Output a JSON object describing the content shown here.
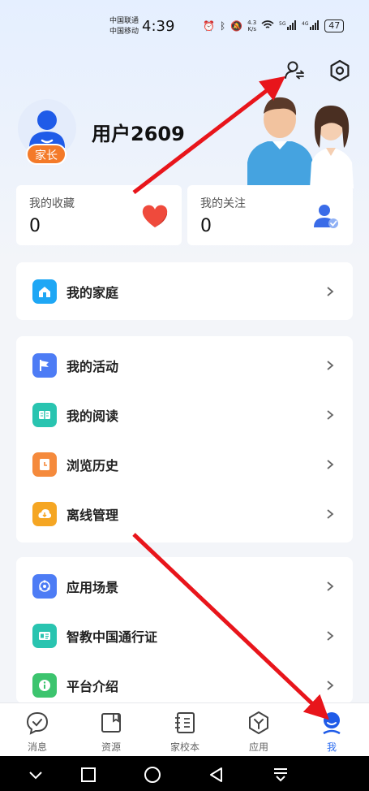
{
  "status_bar": {
    "carrier_1": "中国联通",
    "carrier_2": "中国移动",
    "time": "4:39",
    "net_speed": "4.3\nK/s",
    "battery": "47"
  },
  "profile": {
    "username": "用户2609",
    "role_badge": "家长"
  },
  "stats": [
    {
      "label": "我的收藏",
      "value": "0",
      "icon": "heart-icon"
    },
    {
      "label": "我的关注",
      "value": "0",
      "icon": "user-check-icon"
    }
  ],
  "menu_groups": [
    [
      {
        "label": "我的家庭",
        "icon": "home-icon",
        "color": "#1ea7f5"
      }
    ],
    [
      {
        "label": "我的活动",
        "icon": "flag-icon",
        "color": "#4d7cf5"
      },
      {
        "label": "我的阅读",
        "icon": "book-icon",
        "color": "#29c4b0"
      },
      {
        "label": "浏览历史",
        "icon": "history-icon",
        "color": "#f58a3c"
      },
      {
        "label": "离线管理",
        "icon": "download-icon",
        "color": "#f5a623"
      }
    ],
    [
      {
        "label": "应用场景",
        "icon": "scene-icon",
        "color": "#4d7cf5"
      },
      {
        "label": "智教中国通行证",
        "icon": "id-card-icon",
        "color": "#29c4b0"
      },
      {
        "label": "平台介绍",
        "icon": "info-icon",
        "color": "#3cc46e"
      }
    ]
  ],
  "bottom_nav": [
    {
      "label": "消息",
      "icon": "message-icon"
    },
    {
      "label": "资源",
      "icon": "resource-icon"
    },
    {
      "label": "家校本",
      "icon": "notebook-icon"
    },
    {
      "label": "应用",
      "icon": "apps-icon"
    },
    {
      "label": "我",
      "icon": "me-icon",
      "active": true
    }
  ],
  "colors": {
    "accent": "#2e6ef0",
    "badge": "#f47a29",
    "annotation": "#e8151b"
  }
}
